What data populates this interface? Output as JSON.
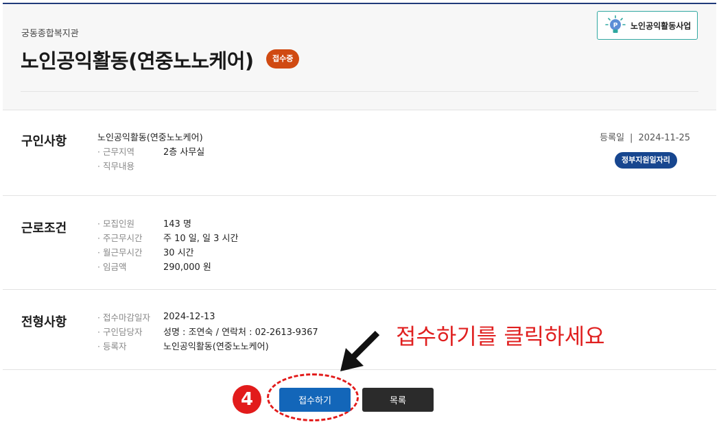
{
  "header": {
    "org": "궁동종합복지관",
    "title": "노인공익활동(연중노노케어)",
    "status_badge": "접수중",
    "program_tag": "노인공익활동사업"
  },
  "sections": {
    "recruit": {
      "title": "구인사항",
      "job_name": "노인공익활동(연중노노케어)",
      "rows": [
        {
          "label": "· 근무지역",
          "value": "2층 사무실"
        },
        {
          "label": "· 직무내용",
          "value": ""
        }
      ],
      "reg_label": "등록일",
      "reg_sep": "|",
      "reg_date": "2024-11-25",
      "gov_badge": "정부지원일자리"
    },
    "conditions": {
      "title": "근로조건",
      "rows": [
        {
          "label": "· 모집인원",
          "value": "143 명"
        },
        {
          "label": "· 주근무시간",
          "value": "주 10 일, 일 3 시간"
        },
        {
          "label": "· 월근무시간",
          "value": "30 시간"
        },
        {
          "label": "· 임금액",
          "value": "290,000 원"
        }
      ]
    },
    "screening": {
      "title": "전형사항",
      "rows": [
        {
          "label": "· 접수마감일자",
          "value": "2024-12-13"
        },
        {
          "label": "· 구인담당자",
          "value": "성명 : 조연숙 / 연락처 : 02-2613-9367"
        },
        {
          "label": "· 등록자",
          "value": "노인공익활동(연중노노케어)"
        }
      ]
    }
  },
  "annotation": {
    "text": "접수하기를 클릭하세요",
    "step_number": "4",
    "color": "#e02020"
  },
  "buttons": {
    "apply": "접수하기",
    "list": "목록"
  },
  "colors": {
    "status_badge": "#d04a12",
    "gov_badge": "#17468f",
    "apply_button": "#1366b9",
    "list_button": "#2b2b2b",
    "tag_border": "#2fa7a0"
  },
  "icons": {
    "program_tag": "lightbulb-icon",
    "arrow": "arrow-down-left-icon"
  }
}
